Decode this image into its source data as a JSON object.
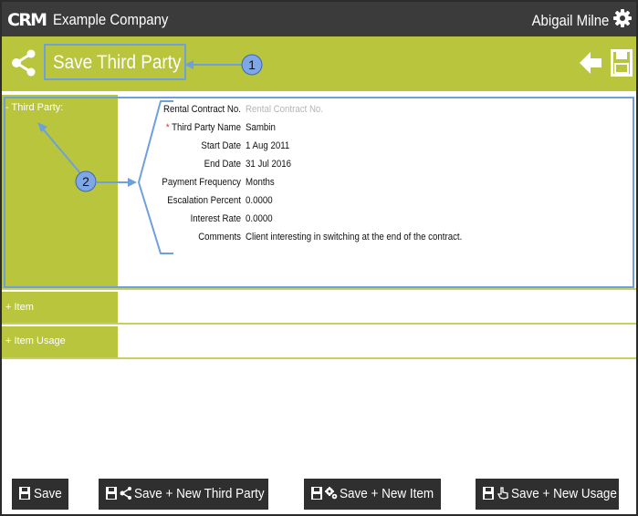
{
  "header": {
    "company": "Example Company",
    "user": "Abigail Milne"
  },
  "page": {
    "title": "Save Third Party"
  },
  "sections": {
    "third_party": {
      "label": "- Third Party:"
    },
    "item": {
      "label": "+ Item"
    },
    "item_usage": {
      "label": "+ Item Usage"
    }
  },
  "fields": {
    "rental_contract_no": {
      "label": "Rental Contract No.",
      "placeholder": "Rental Contract No."
    },
    "third_party_name": {
      "required": "*",
      "label": "Third Party Name",
      "value": "Sambin"
    },
    "start_date": {
      "label": "Start Date",
      "value": "1 Aug 2011"
    },
    "end_date": {
      "label": "End Date",
      "value": "31 Jul 2016"
    },
    "payment_frequency": {
      "label": "Payment Frequency",
      "value": "Months"
    },
    "escalation_percent": {
      "label": "Escalation Percent",
      "value": "0.0000"
    },
    "interest_rate": {
      "label": "Interest Rate",
      "value": "0.0000"
    },
    "comments": {
      "label": "Comments",
      "value": "Client interesting in switching at the end of the contract."
    }
  },
  "buttons": {
    "save": "Save",
    "save_new_third_party": "Save + New Third Party",
    "save_new_item": "Save + New Item",
    "save_new_usage": "Save + New Usage"
  },
  "callouts": {
    "one": "1",
    "two": "2"
  },
  "colors": {
    "accent": "#b9c53c",
    "topbar": "#3b3b3b",
    "highlight": "#6ea0dc",
    "required": "#e0303a"
  }
}
